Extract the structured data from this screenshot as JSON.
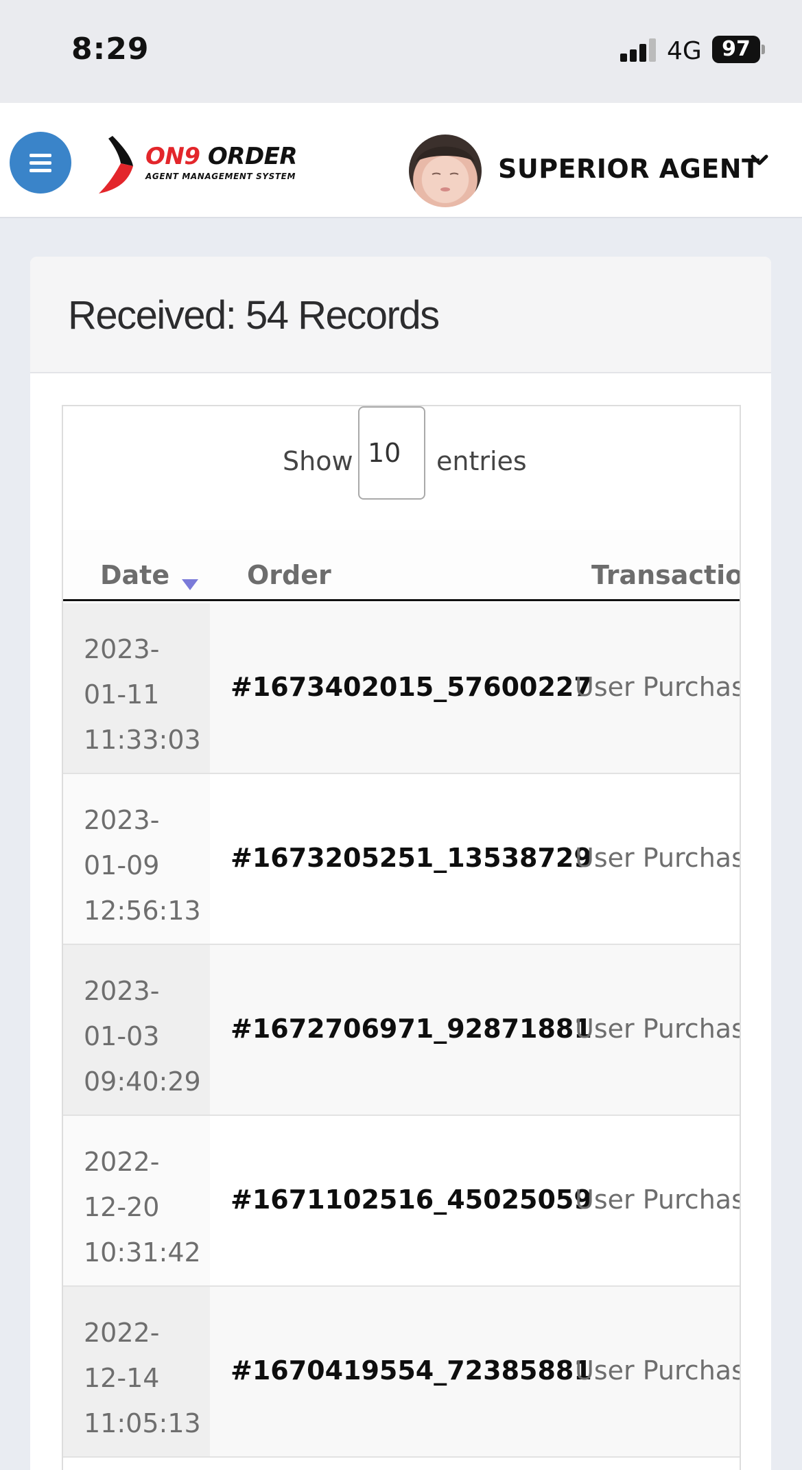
{
  "status_bar": {
    "time": "8:29",
    "network": "4G",
    "battery": "97"
  },
  "header": {
    "logo_main_dark": "ON9",
    "logo_main_red": "ORDER",
    "logo_sub": "AGENT MANAGEMENT SYSTEM",
    "user_name": "SUPERIOR AGENT"
  },
  "card": {
    "title": "Received: 54 Records"
  },
  "table": {
    "length_prefix": "Show",
    "length_value": "10",
    "length_suffix": "entries",
    "columns": {
      "date": "Date",
      "order": "Order",
      "transaction": "Transaction"
    },
    "rows": [
      {
        "date_line1": "2023-",
        "date_line2": "01-11",
        "date_line3": "11:33:03",
        "order": "#1673402015_57600227",
        "transaction": "User Purchase"
      },
      {
        "date_line1": "2023-",
        "date_line2": "01-09",
        "date_line3": "12:56:13",
        "order": "#1673205251_13538729",
        "transaction": "User Purchase"
      },
      {
        "date_line1": "2023-",
        "date_line2": "01-03",
        "date_line3": "09:40:29",
        "order": "#1672706971_92871881",
        "transaction": "User Purchase"
      },
      {
        "date_line1": "2022-",
        "date_line2": "12-20",
        "date_line3": "10:31:42",
        "order": "#1671102516_45025059",
        "transaction": "User Purchase"
      },
      {
        "date_line1": "2022-",
        "date_line2": "12-14",
        "date_line3": "11:05:13",
        "order": "#1670419554_72385881",
        "transaction": "User Purchase"
      }
    ]
  },
  "colors": {
    "menu_button": "#3a84c9",
    "logo_red": "#e3262b",
    "sort_arrow": "#7b7bd9"
  }
}
